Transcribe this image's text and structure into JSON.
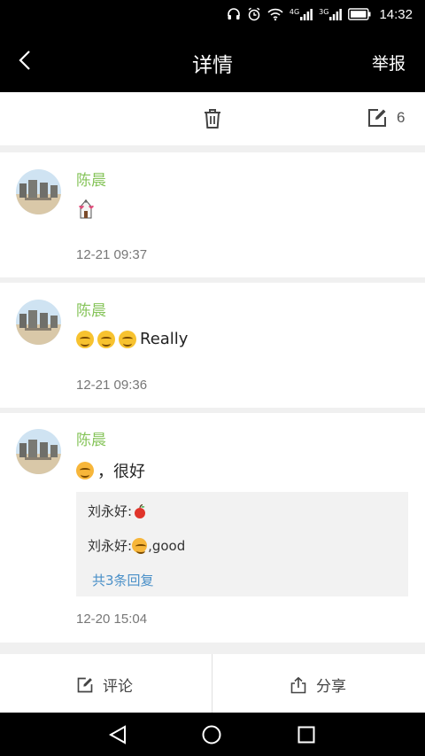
{
  "status_bar": {
    "signal_label_1": "4G",
    "signal_label_2": "3G",
    "time": "14:32"
  },
  "header": {
    "title": "详情",
    "report_label": "举报"
  },
  "toolbar": {
    "edit_count": "6"
  },
  "comments": [
    {
      "author": "陈晨",
      "time": "12-21 09:37"
    },
    {
      "author": "陈晨",
      "text": "Really",
      "time": "12-21 09:36"
    },
    {
      "author": "陈晨",
      "text": "，很好",
      "time": "12-20 15:04",
      "replies": [
        {
          "author": "刘永好:",
          "text": ""
        },
        {
          "author": "刘永好:",
          "text": ",good"
        }
      ],
      "replies_more": "共3条回复"
    }
  ],
  "bottom_actions": {
    "comment_label": "评论",
    "share_label": "分享"
  },
  "colors": {
    "name_green": "#86c45a",
    "link_blue": "#4a90c8"
  }
}
